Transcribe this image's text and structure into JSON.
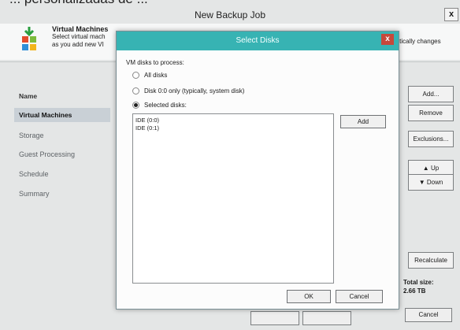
{
  "clipped_caption": "... personalizadas de ...",
  "window": {
    "title": "New Backup Job",
    "close_glyph": "x"
  },
  "header": {
    "title": "Virtual Machines",
    "desc_line1": "Select virtual mach",
    "desc_line2": "as you add new VI",
    "desc_right": "matically changes"
  },
  "column_label": "Name",
  "nav": {
    "items": [
      {
        "label": "Virtual Machines",
        "active": true
      },
      {
        "label": "Storage"
      },
      {
        "label": "Guest Processing"
      },
      {
        "label": "Schedule"
      },
      {
        "label": "Summary"
      }
    ]
  },
  "right_buttons": {
    "add": "Add...",
    "remove": "Remove",
    "exclusions": "Exclusions...",
    "up": "Up",
    "down": "Down",
    "recalculate": "Recalculate"
  },
  "total": {
    "label": "Total size:",
    "value": "2.66 TB"
  },
  "bottom_buttons": {
    "cancel": "Cancel"
  },
  "dialog": {
    "title": "Select Disks",
    "close_glyph": "x",
    "vm_label": "VM disks to process:",
    "options": [
      {
        "label": "All disks",
        "checked": false
      },
      {
        "label": "Disk 0:0 only (typically, system disk)",
        "checked": false
      },
      {
        "label": "Selected disks:",
        "checked": true
      }
    ],
    "disks": [
      "IDE (0:0)",
      "IDE (0:1)"
    ],
    "add_button": "Add",
    "ok_button": "OK",
    "cancel_button": "Cancel"
  },
  "colors": {
    "dialog_title_bar": "#37b3b3",
    "dialog_close": "#c7483b",
    "nav_active": "#c9d0d6",
    "background": "#e4e6e6"
  }
}
